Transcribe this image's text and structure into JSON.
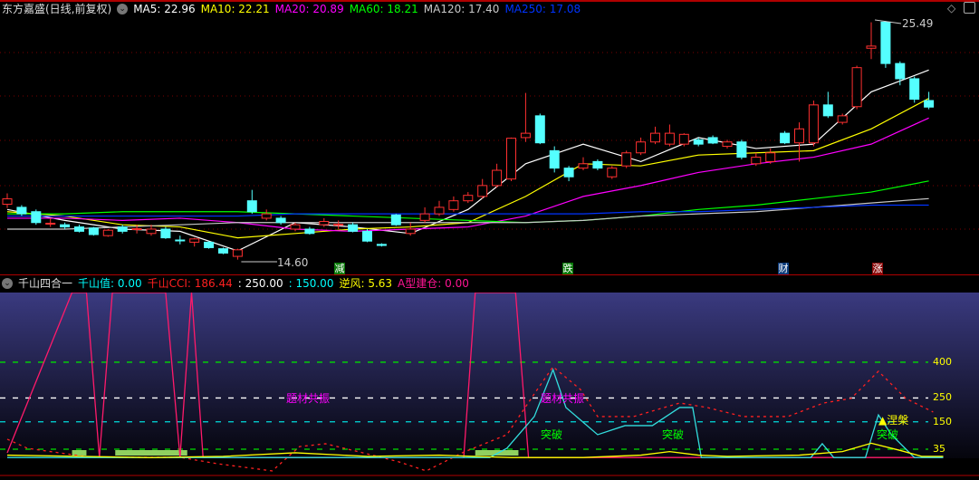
{
  "header": {
    "title": "东方嘉盛(日线,前复权)",
    "ma": [
      {
        "label": "MA5: 22.96",
        "color": "#ffffff"
      },
      {
        "label": "MA10: 22.21",
        "color": "#ffff00"
      },
      {
        "label": "MA20: 20.89",
        "color": "#ff00ff"
      },
      {
        "label": "MA60: 18.21",
        "color": "#00ff00"
      },
      {
        "label": "MA120: 17.40",
        "color": "#c8c8c8"
      },
      {
        "label": "MA250: 17.08",
        "color": "#0033ff"
      }
    ]
  },
  "price_labels": {
    "high": "25.49",
    "low": "14.60"
  },
  "markers": [
    {
      "text": "减",
      "bg": "#0a7a0a"
    },
    {
      "text": "跌",
      "bg": "#0a7a0a"
    },
    {
      "text": "财",
      "bg": "#0a3a7a"
    },
    {
      "text": "涨",
      "bg": "#8a0a0a"
    }
  ],
  "indicator": {
    "title": "千山四合一",
    "items": [
      {
        "label": "千山值: 0.00",
        "color": "#00ffff"
      },
      {
        "label": "千山CCI: 186.44",
        "color": "#ff2020"
      },
      {
        "label": ": 250.00",
        "color": "#ffffff"
      },
      {
        "label": ": 150.00",
        "color": "#00ffff"
      },
      {
        "label": "逆风: 5.63",
        "color": "#ffff00"
      },
      {
        "label": "A型建仓: 0.00",
        "color": "#ff1493"
      }
    ],
    "levels": [
      "400",
      "250",
      "150",
      "35"
    ],
    "annotations": {
      "theme": "题材共振",
      "breakout": "突破",
      "nirvana": "▲涅槃"
    }
  },
  "chart_data": [
    {
      "type": "candlestick",
      "title": "东方嘉盛(日线,前复权)",
      "ylim": [
        14.3,
        25.9
      ],
      "ohlc": [
        [
          17.14,
          17.39,
          17.64,
          16.97
        ],
        [
          17.0,
          16.7,
          17.1,
          16.6
        ],
        [
          16.8,
          16.3,
          16.9,
          16.2
        ],
        [
          16.25,
          16.27,
          16.5,
          16.1
        ],
        [
          16.2,
          16.1,
          16.3,
          16.0
        ],
        [
          16.1,
          15.9,
          16.2,
          15.85
        ],
        [
          16.05,
          15.75,
          16.1,
          15.7
        ],
        [
          15.7,
          15.95,
          16.0,
          15.65
        ],
        [
          16.1,
          15.9,
          16.2,
          15.8
        ],
        [
          16.0,
          16.02,
          16.2,
          15.8
        ],
        [
          15.8,
          16.0,
          16.2,
          15.7
        ],
        [
          16.0,
          15.6,
          16.1,
          15.55
        ],
        [
          15.5,
          15.48,
          15.7,
          15.3
        ],
        [
          15.4,
          15.55,
          15.6,
          15.2
        ],
        [
          15.4,
          15.15,
          15.45,
          15.1
        ],
        [
          15.1,
          14.9,
          15.15,
          14.85
        ],
        [
          14.75,
          15.05,
          15.1,
          14.6
        ],
        [
          17.3,
          16.8,
          17.8,
          16.7
        ],
        [
          16.5,
          16.7,
          16.9,
          16.4
        ],
        [
          16.5,
          16.3,
          16.6,
          16.2
        ],
        [
          16.0,
          16.2,
          16.3,
          15.9
        ],
        [
          16.0,
          15.8,
          16.1,
          15.75
        ],
        [
          16.2,
          16.35,
          16.5,
          16.1
        ],
        [
          16.2,
          16.22,
          16.4,
          16.0
        ],
        [
          16.2,
          15.9,
          16.3,
          15.85
        ],
        [
          15.9,
          15.45,
          16.0,
          15.4
        ],
        [
          15.3,
          15.25,
          15.35,
          15.2
        ],
        [
          16.65,
          16.2,
          16.7,
          16.15
        ],
        [
          15.8,
          16.0,
          16.3,
          15.7
        ],
        [
          16.4,
          16.7,
          17.0,
          16.3
        ],
        [
          16.7,
          17.0,
          17.3,
          16.6
        ],
        [
          16.9,
          17.3,
          17.5,
          16.8
        ],
        [
          17.3,
          17.55,
          17.7,
          17.2
        ],
        [
          17.5,
          18.0,
          18.3,
          17.4
        ],
        [
          18.0,
          18.7,
          19.0,
          17.9
        ],
        [
          18.3,
          20.17,
          20.2,
          18.2
        ],
        [
          20.2,
          20.4,
          22.25,
          20.0
        ],
        [
          21.2,
          19.96,
          21.3,
          19.9
        ],
        [
          19.6,
          18.8,
          19.8,
          18.6
        ],
        [
          18.8,
          18.4,
          18.9,
          18.2
        ],
        [
          18.8,
          19.0,
          19.3,
          18.7
        ],
        [
          19.1,
          18.8,
          19.2,
          18.7
        ],
        [
          18.4,
          18.8,
          18.9,
          18.3
        ],
        [
          18.9,
          19.5,
          19.6,
          18.8
        ],
        [
          19.5,
          20.0,
          20.2,
          19.4
        ],
        [
          20.0,
          20.4,
          20.7,
          19.9
        ],
        [
          19.9,
          20.4,
          20.8,
          19.8
        ],
        [
          19.9,
          20.35,
          20.4,
          19.8
        ],
        [
          20.1,
          19.9,
          20.2,
          19.8
        ],
        [
          20.2,
          19.95,
          20.3,
          19.9
        ],
        [
          19.8,
          20.0,
          20.1,
          19.7
        ],
        [
          20.0,
          19.3,
          20.1,
          19.2
        ],
        [
          19.0,
          19.3,
          19.5,
          18.9
        ],
        [
          19.1,
          19.5,
          19.7,
          19.0
        ],
        [
          20.4,
          19.96,
          20.5,
          19.9
        ],
        [
          19.96,
          20.6,
          20.9,
          19.1
        ],
        [
          19.96,
          21.7,
          21.9,
          19.8
        ],
        [
          21.7,
          21.2,
          22.3,
          21.1
        ],
        [
          20.9,
          21.2,
          21.3,
          20.8
        ],
        [
          21.62,
          23.41,
          23.5,
          21.5
        ],
        [
          24.3,
          24.4,
          25.49,
          23.8
        ],
        [
          25.5,
          23.6,
          25.55,
          23.4
        ],
        [
          23.6,
          22.9,
          23.7,
          22.6
        ],
        [
          22.9,
          21.96,
          23.0,
          21.8
        ],
        [
          21.9,
          21.6,
          22.3,
          21.5
        ]
      ],
      "ma_step": 4,
      "ma": {
        "MA5": [
          16.9,
          16.4,
          16.0,
          15.9,
          15.0,
          16.3,
          16.1,
          15.8,
          16.9,
          19.0,
          19.9,
          19.1,
          20.2,
          19.7,
          19.9,
          22.3,
          23.3
        ],
        "MA10": [
          16.8,
          16.6,
          16.2,
          16.1,
          15.6,
          15.8,
          16.0,
          16.1,
          16.3,
          17.5,
          19.0,
          18.9,
          19.4,
          19.5,
          19.6,
          20.6,
          22.0
        ],
        "MA20": [
          16.5,
          16.5,
          16.4,
          16.5,
          16.3,
          16.0,
          15.9,
          16.0,
          16.1,
          16.6,
          17.5,
          18.0,
          18.6,
          19.0,
          19.3,
          19.9,
          21.1
        ],
        "MA60": [
          16.7,
          16.7,
          16.8,
          16.8,
          16.8,
          16.7,
          16.6,
          16.5,
          16.4,
          16.3,
          16.4,
          16.6,
          16.9,
          17.1,
          17.4,
          17.7,
          18.21
        ],
        "MA120": [
          16.0,
          16.0,
          16.1,
          16.2,
          16.3,
          16.3,
          16.3,
          16.3,
          16.3,
          16.3,
          16.4,
          16.6,
          16.7,
          16.8,
          17.0,
          17.2,
          17.4
        ],
        "MA250": [
          16.6,
          16.6,
          16.6,
          16.6,
          16.6,
          16.7,
          16.7,
          16.7,
          16.7,
          16.7,
          16.7,
          16.8,
          16.8,
          16.9,
          17.0,
          17.1,
          17.1
        ]
      }
    },
    {
      "type": "line",
      "title": "千山四合一",
      "ylim": [
        -30,
        685
      ],
      "levels": [
        400,
        250,
        150,
        35
      ],
      "series": {
        "A型建仓": [
          [
            0,
            20
          ],
          [
            4.5,
            700
          ],
          [
            5.5,
            700
          ],
          [
            6.4,
            0
          ],
          [
            7.3,
            700
          ],
          [
            11,
            700
          ],
          [
            12,
            0
          ],
          [
            12.8,
            700
          ],
          [
            13.6,
            0
          ],
          [
            31.7,
            0
          ],
          [
            32.5,
            700
          ],
          [
            35.3,
            700
          ],
          [
            36.2,
            0
          ],
          [
            65,
            0
          ]
        ],
        "千山CCI": [
          [
            0,
            77
          ],
          [
            1.4,
            39
          ],
          [
            5.8,
            1
          ],
          [
            9,
            1
          ],
          [
            12,
            1
          ],
          [
            14.6,
            -26
          ],
          [
            18.4,
            -56
          ],
          [
            20.3,
            46
          ],
          [
            22.1,
            58
          ],
          [
            24.7,
            20
          ],
          [
            27.2,
            -18
          ],
          [
            29.1,
            -56
          ],
          [
            31.6,
            20
          ],
          [
            34.7,
            96
          ],
          [
            36.6,
            267
          ],
          [
            37.9,
            381
          ],
          [
            39.8,
            286
          ],
          [
            41,
            172
          ],
          [
            43.5,
            172
          ],
          [
            46.7,
            229
          ],
          [
            48.6,
            210
          ],
          [
            51.1,
            172
          ],
          [
            54.2,
            172
          ],
          [
            56.7,
            229
          ],
          [
            58.6,
            248
          ],
          [
            60.5,
            362
          ],
          [
            62.4,
            248
          ],
          [
            64.3,
            191
          ]
        ],
        "千山值": [
          [
            0,
            0
          ],
          [
            33.5,
            0
          ],
          [
            34.7,
            39
          ],
          [
            36.6,
            172
          ],
          [
            37.9,
            369
          ],
          [
            38.8,
            210
          ],
          [
            41,
            96
          ],
          [
            42.9,
            134
          ],
          [
            44.8,
            134
          ],
          [
            46.7,
            210
          ],
          [
            47.6,
            210
          ],
          [
            48.2,
            0
          ],
          [
            55.8,
            0
          ],
          [
            56.6,
            58
          ],
          [
            57.4,
            0
          ],
          [
            59.6,
            0
          ],
          [
            60.5,
            179
          ],
          [
            61.4,
            96
          ],
          [
            63,
            0
          ],
          [
            65,
            0
          ]
        ],
        "逆风": [
          [
            0,
            10
          ],
          [
            5,
            5
          ],
          [
            10,
            0
          ],
          [
            15,
            5
          ],
          [
            20,
            20
          ],
          [
            25,
            5
          ],
          [
            30,
            10
          ],
          [
            35,
            0
          ],
          [
            40,
            0
          ],
          [
            44,
            10
          ],
          [
            46,
            25
          ],
          [
            48,
            10
          ],
          [
            50,
            5
          ],
          [
            55,
            10
          ],
          [
            58,
            25
          ],
          [
            60,
            60
          ],
          [
            62,
            30
          ],
          [
            63.5,
            5
          ],
          [
            65,
            5
          ]
        ],
        "建仓柱": [
          [
            4.5,
            5.5
          ],
          [
            7.5,
            12.5
          ],
          [
            32.5,
            35.5
          ]
        ]
      }
    }
  ]
}
